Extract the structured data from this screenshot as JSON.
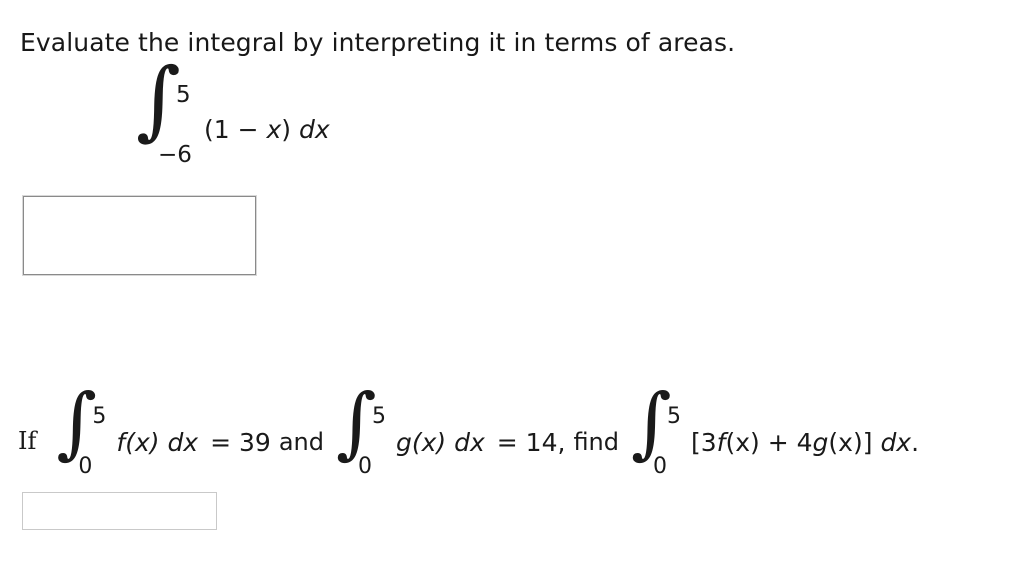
{
  "page": {
    "background": "#ffffff",
    "text_color": "#1a1a1a"
  },
  "question1": {
    "prompt": "Evaluate the integral by interpreting it in terms of areas.",
    "integral": {
      "sign": "∫",
      "upper_limit": "5",
      "lower_limit": "−6",
      "integrand": "(1 − x) dx",
      "integrand_parts": {
        "open_paren": "(1 − ",
        "variable": "x",
        "close_paren": ") ",
        "differential": "dx"
      }
    },
    "answer_field": {
      "value": "",
      "placeholder": "",
      "border_color": "#8a8a8a"
    }
  },
  "question2": {
    "if_label": "If",
    "integral_f": {
      "sign": "∫",
      "upper_limit": "5",
      "lower_limit": "0",
      "integrand_fn": "f",
      "integrand": "(x) ",
      "differential": "dx"
    },
    "equals_f": "= 39",
    "conjunction": "and",
    "integral_g": {
      "sign": "∫",
      "upper_limit": "5",
      "lower_limit": "0",
      "integrand_fn": "g",
      "integrand": "(x) ",
      "differential": "dx"
    },
    "equals_g": "= 14,",
    "find_word": "find",
    "integral_target": {
      "sign": "∫",
      "upper_limit": "5",
      "lower_limit": "0",
      "expression_open": "[3",
      "fn1": "f",
      "mid1": "(x) + 4",
      "fn2": "g",
      "mid2": "(x)] ",
      "differential": "dx",
      "period": "."
    },
    "answer_field": {
      "value": "",
      "placeholder": "",
      "border_color": "#c9c9c9"
    }
  }
}
